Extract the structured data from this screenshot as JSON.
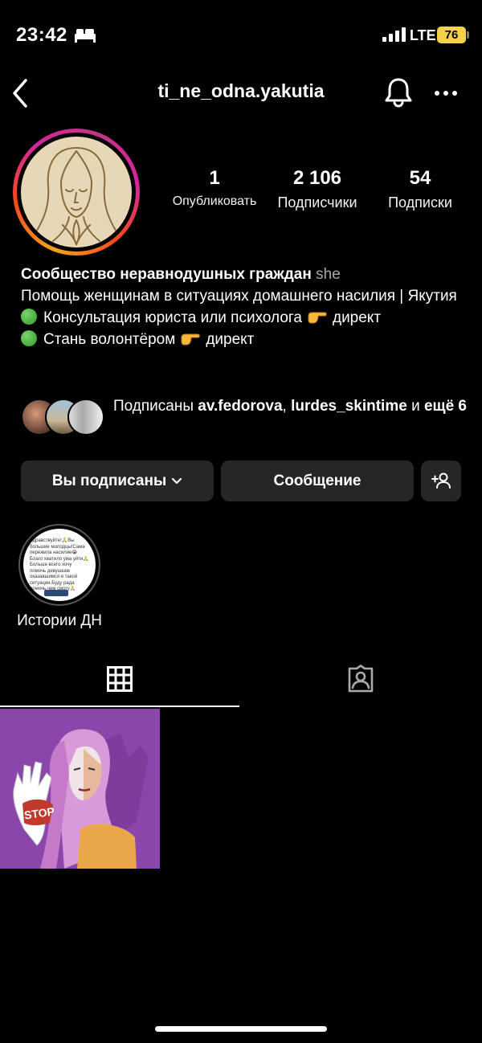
{
  "status_bar": {
    "time": "23:42",
    "network": "LTE",
    "battery": "76"
  },
  "nav": {
    "username": "ti_ne_odna.yakutia",
    "icons": [
      "chevron-left-icon",
      "bell-icon",
      "more-icon"
    ]
  },
  "stats": {
    "posts": {
      "value": "1",
      "label": "Опубликовать"
    },
    "followers": {
      "value": "2 106",
      "label": "Подписчики"
    },
    "following": {
      "value": "54",
      "label": "Подписки"
    }
  },
  "bio": {
    "name": "Сообщество неравнодушных граждан",
    "pronoun": "she",
    "line1": "Помощь женщинам в ситуациях домашнего насилия | Якутия",
    "line2": "Консультация юриста или психолога",
    "line2_suffix": "директ",
    "line3": "Стань волонтёром",
    "line3_suffix": "директ"
  },
  "mutual": {
    "prefix": "Подписаны",
    "user1": "av.fedorova",
    "user2": "lurdes_skintime",
    "conjunction": "и",
    "more": "ещё 6"
  },
  "buttons": {
    "following": "Вы подписаны",
    "message": "Сообщение"
  },
  "highlights": [
    {
      "label": "Истории ДН",
      "preview_text": "Здравствуйте!🙏Вы большие молодцы!Сама пережила насилие😭Благо хватило ума уйти🙏 Больше всего хочу помочь девушкам оказавшимся в такой ситуации.Буду рада помочь,чем смогу🙏"
    }
  ],
  "tabs": [
    "grid-icon",
    "tagged-icon"
  ],
  "post": {
    "stop_text": "STOP"
  },
  "colors": {
    "background": "#000000",
    "button_bg": "#262626",
    "secondary_text": "#a8a8a8",
    "battery": "#f5d04a",
    "post_bg": "#8a46ab"
  }
}
